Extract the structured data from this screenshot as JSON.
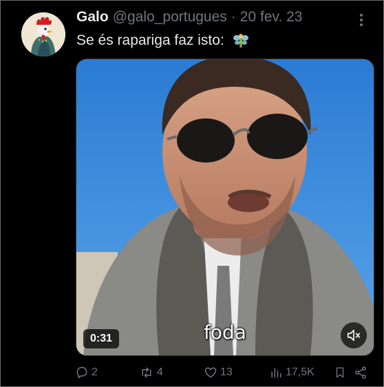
{
  "tweet": {
    "author_name": "Galo",
    "handle": "@galo_portugues",
    "separator": "·",
    "date": "20 fev. 23",
    "text": "Se és rapariga faz isto:",
    "text_emoji_icon": "fairy-emoji-icon"
  },
  "video": {
    "subtitle": "foda",
    "duration": "0:31",
    "muted": true
  },
  "actions": {
    "replies": "2",
    "retweets": "4",
    "likes": "13",
    "views": "17,5K"
  },
  "colors": {
    "background": "#000000",
    "text_primary": "#e7e9ea",
    "text_secondary": "#71767b",
    "sky": "#2f7fd6"
  }
}
